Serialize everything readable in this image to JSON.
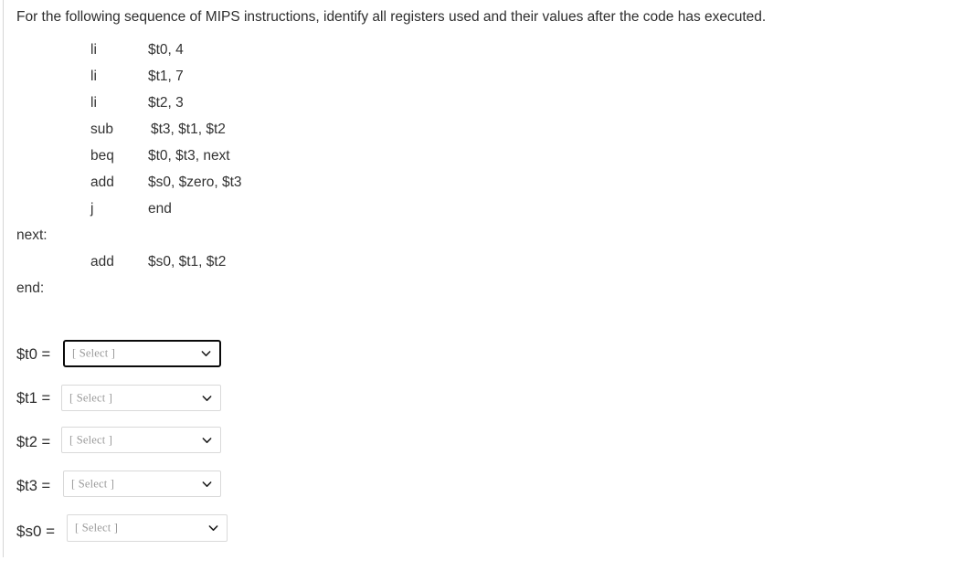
{
  "question": {
    "prompt": "For the following sequence of MIPS instructions, identify all registers used and their values after the code has executed."
  },
  "code": {
    "lines": [
      {
        "label": "",
        "mnemonic": "li",
        "operands": "$t0, 4"
      },
      {
        "label": "",
        "mnemonic": "li",
        "operands": "$t1, 7"
      },
      {
        "label": "",
        "mnemonic": "li",
        "operands": "$t2, 3"
      },
      {
        "label": "",
        "mnemonic": "sub",
        "operands": "$t3, $t1, $t2"
      },
      {
        "label": "",
        "mnemonic": "beq",
        "operands": "$t0, $t3, next"
      },
      {
        "label": "",
        "mnemonic": "add",
        "operands": "$s0, $zero, $t3"
      },
      {
        "label": "",
        "mnemonic": "j",
        "operands": "end"
      },
      {
        "label": "next:",
        "mnemonic": "",
        "operands": ""
      },
      {
        "label": "",
        "mnemonic": "add",
        "operands": "$s0, $t1, $t2"
      },
      {
        "label": "end:",
        "mnemonic": "",
        "operands": ""
      }
    ]
  },
  "answers": {
    "placeholder": "[ Select ]",
    "rows": [
      {
        "register": "$t0 =",
        "value": "[ Select ]"
      },
      {
        "register": "$t1 =",
        "value": "[ Select ]"
      },
      {
        "register": "$t2 =",
        "value": "[ Select ]"
      },
      {
        "register": "$t3 =",
        "value": "[ Select ]"
      },
      {
        "register": "$s0 =",
        "value": "[ Select ]"
      }
    ]
  },
  "icons": {
    "chevron": "chevron-down-icon"
  },
  "colors": {
    "text": "#2d2d2d",
    "border": "#d9d9d9",
    "focus_border": "#0a0a0a",
    "placeholder": "#9a9a9a",
    "rule": "#d6d6d6"
  }
}
